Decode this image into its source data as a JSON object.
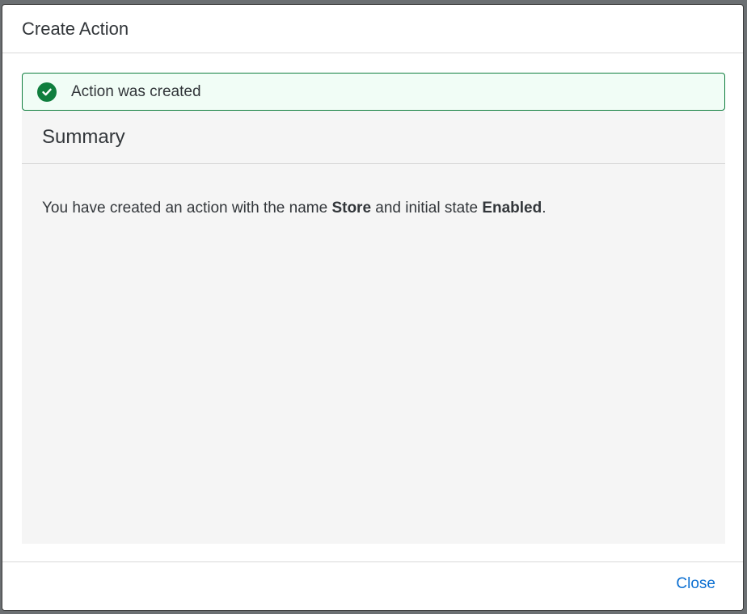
{
  "dialog": {
    "title": "Create Action"
  },
  "message": {
    "text": "Action was created",
    "icon": "check-circle-icon",
    "status_color": "#107e3e"
  },
  "summary": {
    "title": "Summary",
    "text_before_name": "You have created an action with the name ",
    "name": "Store",
    "text_before_state": " and initial state ",
    "state": "Enabled",
    "text_end": "."
  },
  "footer": {
    "close_label": "Close",
    "accent_color": "#0a6ed1"
  }
}
